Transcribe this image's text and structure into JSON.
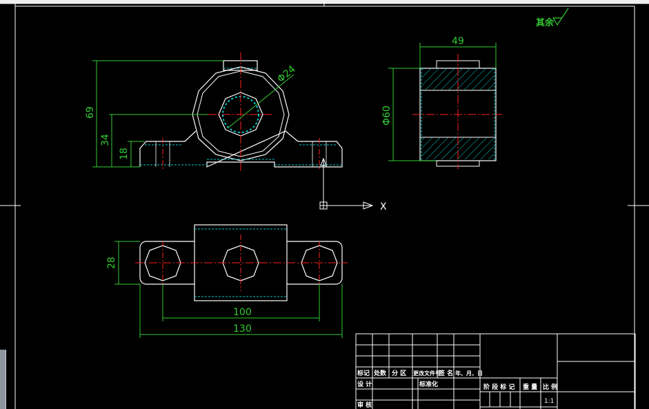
{
  "roughness_note": "其余",
  "front_view": {
    "height_dim": "69",
    "mid_height_dim": "34",
    "base_height_dim": "18",
    "bore_dim": "Φ24"
  },
  "side_view": {
    "width_dim": "49",
    "diameter_dim": "Φ60"
  },
  "top_view": {
    "width_dim": "28",
    "hole_spacing_dim": "100",
    "overall_length_dim": "130"
  },
  "ucs": {
    "x_label": "X"
  },
  "title_block": {
    "row1": [
      "标记",
      "处数",
      "分 区",
      "更改文件号",
      "签 名",
      "年、月、日"
    ],
    "design_label": "设 计",
    "standard_label": "标准化",
    "review_label": "审 核",
    "stage_headers": [
      "阶 段 标 记",
      "重 量",
      "比 例"
    ],
    "scale_value": "1:1"
  },
  "colors": {
    "outline": "#ffffff",
    "dimension": "#33cc33",
    "centerline": "#ff2222",
    "hatch": "#00cccc",
    "background": "#000000"
  }
}
